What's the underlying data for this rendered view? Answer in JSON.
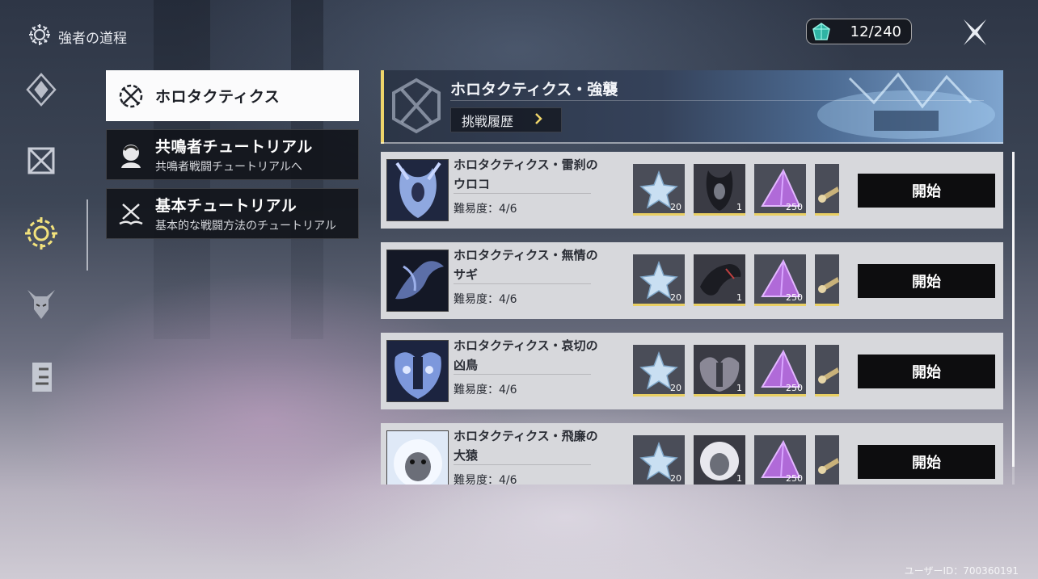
{
  "header": {
    "mode_title": "強者の道程"
  },
  "currency": {
    "value": "12/240",
    "icon": "crystal-icon"
  },
  "rail": {
    "items": [
      {
        "icon": "diamond-star-icon",
        "active": false
      },
      {
        "icon": "crossed-blades-icon",
        "active": false
      },
      {
        "icon": "gear-sun-icon",
        "active": true
      },
      {
        "icon": "demon-head-icon",
        "active": false
      },
      {
        "icon": "banner-flag-icon",
        "active": false
      }
    ]
  },
  "categories": [
    {
      "title": "ホロタクティクス",
      "subtitle": "",
      "icon": "holo-tactics-icon",
      "active": true
    },
    {
      "title": "共鳴者チュートリアル",
      "subtitle": "共鳴者戦闘チュートリアルへ",
      "icon": "resonator-portrait-icon",
      "active": false
    },
    {
      "title": "基本チュートリアル",
      "subtitle": "基本的な戦闘方法のチュートリアル",
      "icon": "book-swords-icon",
      "active": false
    }
  ],
  "banner": {
    "title": "ホロタクティクス・強襲",
    "history_label": "挑戦履歴"
  },
  "challenges": [
    {
      "name_line1": "ホロタクティクス・雷刹の",
      "name_line2": "ウロコ",
      "difficulty": "難易度：4/6",
      "portrait": "thundering-mephis-portrait",
      "rewards": [
        {
          "icon": "shell-star-icon",
          "qty": "20"
        },
        {
          "icon": "echo-monster-icon",
          "qty": "1"
        },
        {
          "icon": "purple-tuner-icon",
          "qty": "250"
        },
        {
          "icon": "scroll-icon",
          "qty": ""
        }
      ],
      "start_label": "開始"
    },
    {
      "name_line1": "ホロタクティクス・無情の",
      "name_line2": "サギ",
      "difficulty": "難易度：4/6",
      "portrait": "heron-portrait",
      "rewards": [
        {
          "icon": "shell-star-icon",
          "qty": "20"
        },
        {
          "icon": "echo-monster-icon",
          "qty": "1"
        },
        {
          "icon": "purple-tuner-icon",
          "qty": "250"
        },
        {
          "icon": "scroll-icon",
          "qty": ""
        }
      ],
      "start_label": "開始"
    },
    {
      "name_line1": "ホロタクティクス・哀切の",
      "name_line2": "凶鳥",
      "difficulty": "難易度：4/6",
      "portrait": "mourning-bird-portrait",
      "rewards": [
        {
          "icon": "shell-star-icon",
          "qty": "20"
        },
        {
          "icon": "echo-monster-icon",
          "qty": "1"
        },
        {
          "icon": "purple-tuner-icon",
          "qty": "250"
        },
        {
          "icon": "scroll-icon",
          "qty": ""
        }
      ],
      "start_label": "開始"
    },
    {
      "name_line1": "ホロタクティクス・飛廉の",
      "name_line2": "大猿",
      "difficulty": "難易度：4/6",
      "portrait": "feilian-ape-portrait",
      "rewards": [
        {
          "icon": "shell-star-icon",
          "qty": "20"
        },
        {
          "icon": "echo-monster-icon",
          "qty": "1"
        },
        {
          "icon": "purple-tuner-icon",
          "qty": "250"
        },
        {
          "icon": "scroll-icon",
          "qty": ""
        }
      ],
      "start_label": "開始"
    }
  ],
  "footer": {
    "user_id": "ユーザーID：700360191"
  },
  "colors": {
    "accent_gold": "#efd56a",
    "active_rail": "#f2e27c",
    "start_button": "#0d0d0f"
  }
}
